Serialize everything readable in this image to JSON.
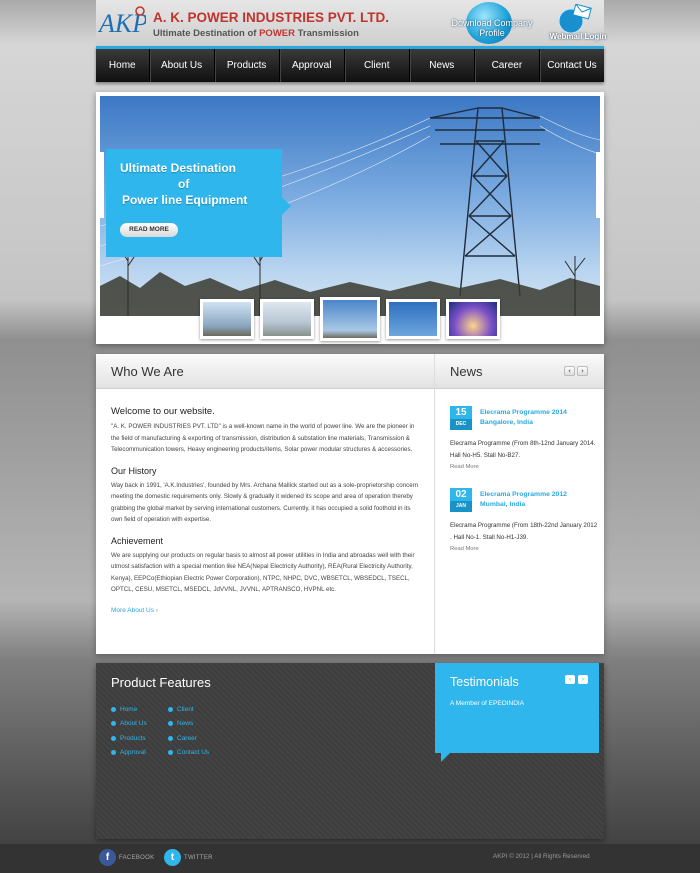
{
  "header": {
    "logo_text": "AKPI",
    "company_name": "A. K. POWER INDUSTRIES PVT. LTD.",
    "tagline_pre": "Ultimate Destination of ",
    "tagline_highlight": "POWER",
    "tagline_post": " Transmission",
    "download_label": "Download Company Profile",
    "webmail_label": "Webmail Login"
  },
  "nav": {
    "items": [
      "Home",
      "About Us",
      "Products",
      "Approval",
      "Client",
      "News",
      "Career",
      "Contact Us"
    ]
  },
  "slider": {
    "caption_line1": "Ultimate  Destination",
    "caption_line2": "of",
    "caption_line3": "Power line Equipment",
    "read_more": "READ MORE"
  },
  "who": {
    "title": "Who We Are",
    "welcome": "Welcome to our website.",
    "intro": "\"A. K. POWER INDUSTRIES PVT. LTD\" is a well-known name in the world of power line. We are the pioneer in the field of manufacturing & exporting of transmission, distribution & substation line materials, Transmission & Telecommunication towers, Heavy engineering products/items, Solar power modular structures & accessories.",
    "history_title": "Our History",
    "history": "Way back in 1991, 'A.K.Industries', founded by Mrs. Archana Mallick started out as a sole-proprietorship concern meeting the domestic requirements only. Slowly & gradually it widened its scope and area of operation thereby grabbing the global market by serving international customers. Currently, it has occupied a solid foothold in its own field of operation with expertise.",
    "achievement_title": "Achievement",
    "achievement": "We are supplying our products on regular basis to almost all power utilities in India and abroadas well with their utmost satisfaction with a special mention like NEA(Nepal Electricity Authority), REA(Rural Electricity Authority, Kenya), EEPCo(Ethiopian Electric Power Corporation), NTPC, NHPC, DVC, WBSETCL, WBSEDCL, TSECL, OPTCL, CESU, MSETCL, MSEDCL, JdVVNL, JVVNL, APTRANSCO, HVPNL etc.",
    "more_link": "More About Us"
  },
  "news": {
    "title": "News",
    "prev": "‹",
    "next": "›",
    "items": [
      {
        "day": "15",
        "month": "DEC",
        "title": "Elecrama Programme 2014 Bangalore, India",
        "desc": "Elecrama Programme (From 8th-12nd January 2014. Hall No-H5. Stall No-B27.",
        "more": "Read More"
      },
      {
        "day": "02",
        "month": "JAN",
        "title": "Elecrama Programme 2012 Mumbai, India",
        "desc": "Elecrama Programme (From 18th-22nd January 2012 . Hall No-1. Stall No-H1-J39.",
        "more": "Read More"
      }
    ]
  },
  "features": {
    "title": "Product Features",
    "col1": [
      "Home",
      "About Us",
      "Products",
      "Approval"
    ],
    "col2": [
      "Client",
      "News",
      "Career",
      "Contact Us"
    ]
  },
  "testimonials": {
    "title": "Testimonials",
    "text": "A Member of EPEOINDIA",
    "prev": "‹",
    "next": "›"
  },
  "footer": {
    "facebook": "FACEBOOK",
    "twitter": "TWITTER",
    "copyright": "AKPI © 2012 | All Rights Reserved"
  },
  "colors": {
    "accent": "#2fb6ec",
    "brand_red": "#c0342c",
    "nav_bg": "#1a1a1a"
  }
}
